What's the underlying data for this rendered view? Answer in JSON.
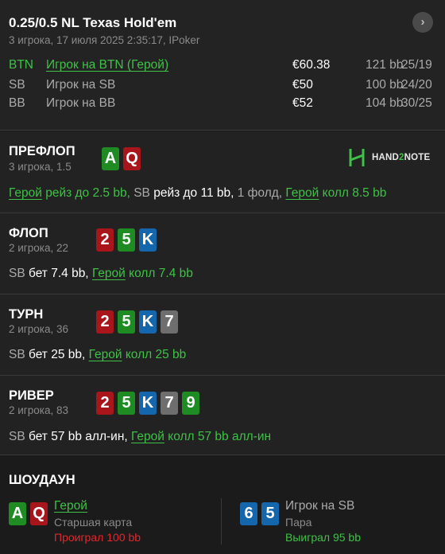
{
  "header": {
    "title": "0.25/0.5 NL Texas Hold'em",
    "subtitle": "3 игрока, 17 июля 2025 2:35:17, IPoker",
    "next_icon": "chevron-right-icon",
    "next_glyph": "›"
  },
  "players": [
    {
      "pos": "BTN",
      "name": "Игрок на BTN (Герой)",
      "stack": "€60.38",
      "bb": "121 bb",
      "dot": "·",
      "stat": "25/19",
      "hero": true
    },
    {
      "pos": "SB",
      "name": "Игрок на SB",
      "stack": "€50",
      "bb": "100 bb",
      "dot": "·",
      "stat": "24/20",
      "hero": false
    },
    {
      "pos": "BB",
      "name": "Игрок на BB",
      "stack": "€52",
      "bb": "104 bb",
      "dot": "·",
      "stat": "30/25",
      "hero": false
    }
  ],
  "logo": {
    "text_main": "HAND",
    "text_two": "2",
    "text_tail": "NOTE"
  },
  "streets": {
    "preflop": {
      "name": "ПРЕФЛОП",
      "sub": "3 игрока, 1.5",
      "cards": [
        {
          "rank": "A",
          "color": "#1e8c23"
        },
        {
          "rank": "Q",
          "color": "#a8161c"
        }
      ],
      "a1": "Герой",
      "a2": "рейз до 2.5 bb,",
      "a3": "SB",
      "a4": "рейз до 11 bb,",
      "a5": "1 фолд,",
      "a6": "Герой",
      "a7": "колл 8.5 bb"
    },
    "flop": {
      "name": "ФЛОП",
      "sub": "2 игрока, 22",
      "cards": [
        {
          "rank": "2",
          "color": "#a8161c"
        },
        {
          "rank": "5",
          "color": "#1e8c23"
        },
        {
          "rank": "K",
          "color": "#1467ad"
        }
      ],
      "a1": "SB",
      "a2": "бет 7.4 bb,",
      "a3": "Герой",
      "a4": "колл 7.4 bb"
    },
    "turn": {
      "name": "ТУРН",
      "sub": "2 игрока, 36",
      "cards": [
        {
          "rank": "2",
          "color": "#a8161c"
        },
        {
          "rank": "5",
          "color": "#1e8c23"
        },
        {
          "rank": "K",
          "color": "#1467ad"
        },
        {
          "rank": "7",
          "color": "#6e6e6e"
        }
      ],
      "a1": "SB",
      "a2": "бет 25 bb,",
      "a3": "Герой",
      "a4": "колл 25 bb"
    },
    "river": {
      "name": "РИВЕР",
      "sub": "2 игрока, 83",
      "cards": [
        {
          "rank": "2",
          "color": "#a8161c"
        },
        {
          "rank": "5",
          "color": "#1e8c23"
        },
        {
          "rank": "K",
          "color": "#1467ad"
        },
        {
          "rank": "7",
          "color": "#6e6e6e"
        },
        {
          "rank": "9",
          "color": "#1e8c23"
        }
      ],
      "a1": "SB",
      "a2": "бет 57 bb алл-ин,",
      "a3": "Герой",
      "a4": "колл 57 bb алл-ин"
    }
  },
  "showdown": {
    "title": "ШОУДАУН",
    "hero": {
      "cards": [
        {
          "rank": "A",
          "color": "#1e8c23"
        },
        {
          "rank": "Q",
          "color": "#a8161c"
        }
      ],
      "name": "Герой",
      "hand": "Старшая карта",
      "result": "Проиграл 100 bb",
      "result_color": "#e0282e"
    },
    "villain": {
      "cards": [
        {
          "rank": "6",
          "color": "#1467ad"
        },
        {
          "rank": "5",
          "color": "#1467ad"
        }
      ],
      "name": "Игрок на SB",
      "hand": "Пара",
      "result": "Выиграл 95 bb",
      "result_color": "#3ec146"
    }
  },
  "colors": {
    "hero_green": "#3ec146",
    "loss_red": "#e0282e"
  }
}
